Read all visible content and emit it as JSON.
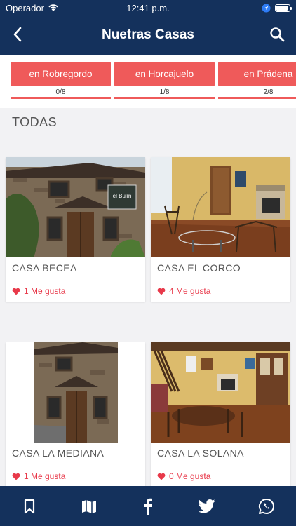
{
  "status": {
    "carrier": "Operador",
    "time": "12:41 p.m.",
    "battery_level": 0.9
  },
  "nav": {
    "title": "Nuetras Casas",
    "back_icon": "chevron-left-icon",
    "search_icon": "search-icon"
  },
  "villages": [
    {
      "label": "en Robregordo",
      "count": "0/8"
    },
    {
      "label": "en Horcajuelo",
      "count": "1/8"
    },
    {
      "label": "en Prádena",
      "count": "2/8"
    }
  ],
  "section_title": "TODAS",
  "houses": [
    {
      "name": "CASA BECEA",
      "likes": "1 Me gusta"
    },
    {
      "name": "CASA EL CORCO",
      "likes": "4 Me gusta"
    },
    {
      "name": "CASA LA MEDIANA",
      "likes": "1 Me gusta"
    },
    {
      "name": "CASA LA SOLANA",
      "likes": "0 Me gusta"
    }
  ],
  "photo_signs": {
    "becea_sign": "el Bulín"
  },
  "tabs": [
    {
      "name": "bookmark-icon"
    },
    {
      "name": "map-icon"
    },
    {
      "name": "facebook-icon"
    },
    {
      "name": "twitter-icon"
    },
    {
      "name": "whatsapp-icon"
    }
  ],
  "colors": {
    "nav": "#14315c",
    "accent": "#ef5a5a",
    "like": "#e8394a"
  }
}
